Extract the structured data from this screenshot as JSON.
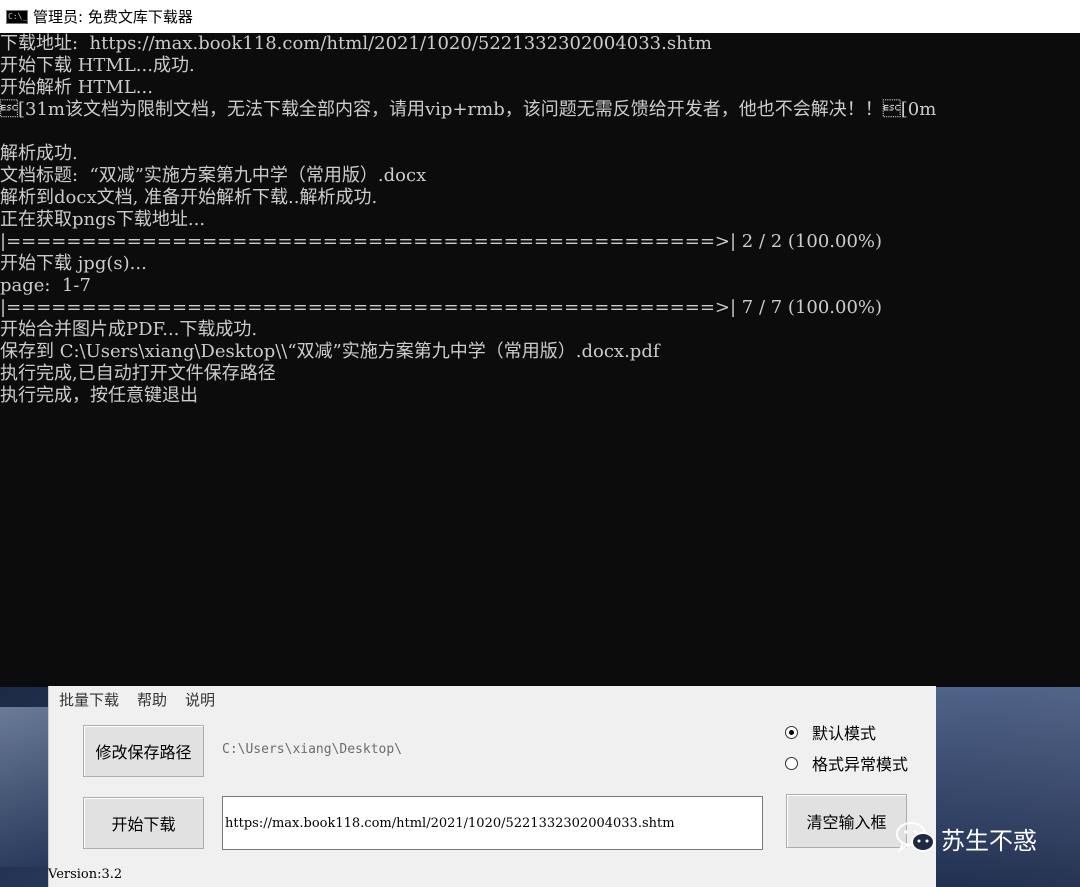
{
  "window": {
    "title": "管理员: 免费文库下载器"
  },
  "console": {
    "lines": [
      "下载地址:  https://max.book118.com/html/2021/1020/5221332302004033.shtm",
      "开始下载 HTML...成功.",
      "开始解析 HTML...",
      "\u001b[31m该文档为限制文档，无法下载全部内容，请用vip+rmb，该问题无需反馈给开发者，他也不会解决！！\u001b[0m",
      "",
      "解析成功.",
      "文档标题:  “双减”实施方案第九中学（常用版）.docx",
      "解析到docx文档, 准备开始解析下载..解析成功.",
      "正在获取pngs下载地址...",
      "|===============================================>| 2 / 2 (100.00%)",
      "开始下载 jpg(s)...",
      "page:  1-7",
      "|===============================================>| 7 / 7 (100.00%)",
      "开始合并图片成PDF...下载成功.",
      "保存到 C:\\Users\\xiang\\Desktop\\\\“双减”实施方案第九中学（常用版）.docx.pdf",
      "执行完成,已自动打开文件保存路径",
      "执行完成，按任意键退出"
    ]
  },
  "gui": {
    "menu": [
      "批量下载",
      "帮助",
      "说明"
    ],
    "change_path_button": "修改保存路径",
    "save_path": "C:\\Users\\xiang\\Desktop\\",
    "mode_default": "默认模式",
    "mode_abnormal": "格式异常模式",
    "start_button": "开始下载",
    "url_value": "https://max.book118.com/html/2021/1020/5221332302004033.shtm",
    "clear_button": "清空输入框",
    "version": "Version:3.2"
  },
  "watermark": {
    "text": "苏生不惑",
    "icon": "wechat-icon"
  }
}
